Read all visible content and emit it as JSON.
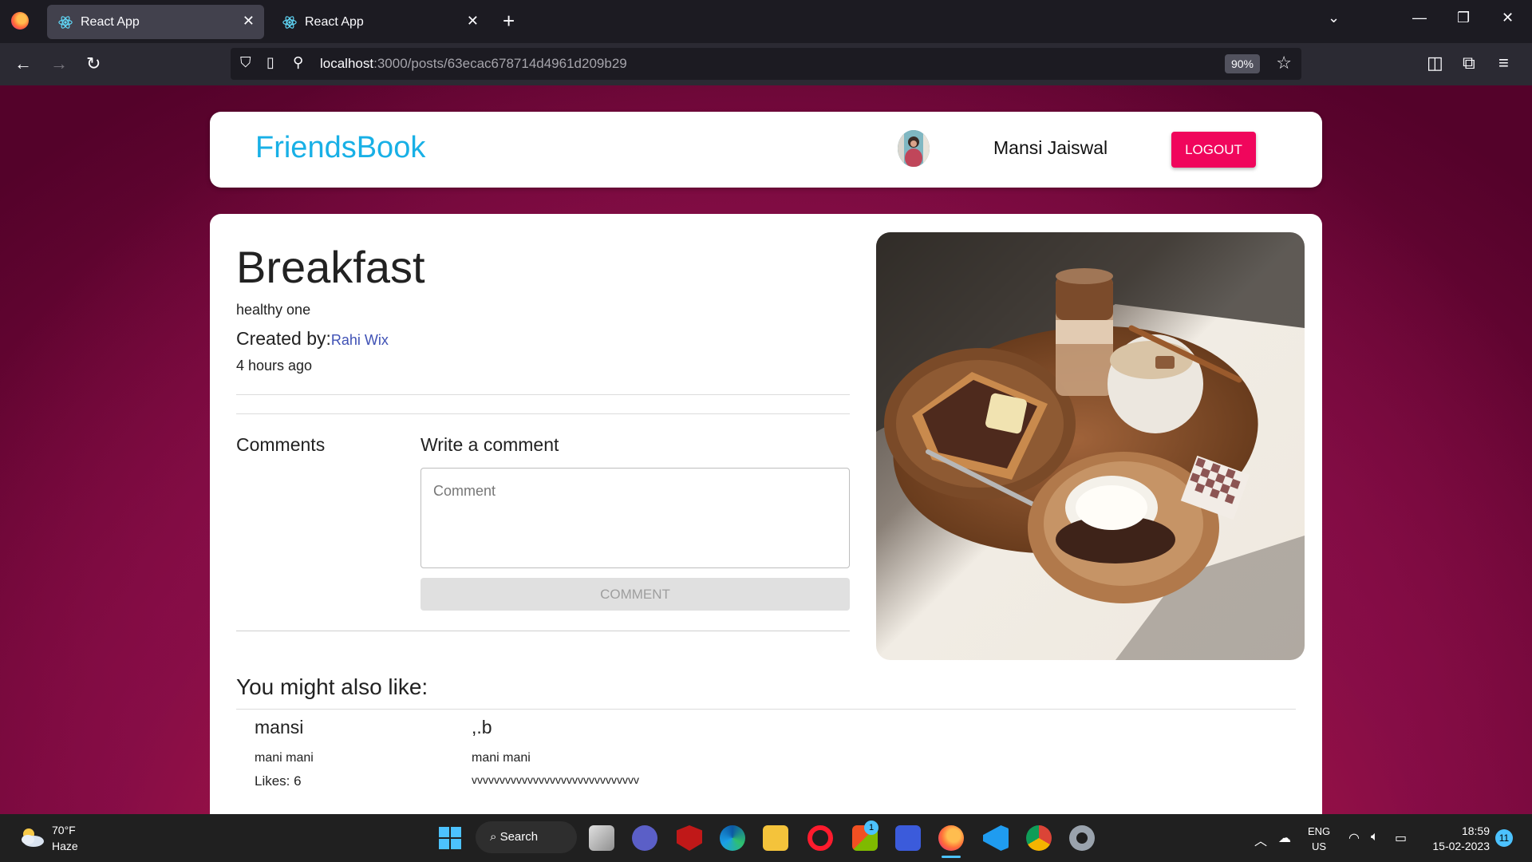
{
  "browser": {
    "tabs": [
      {
        "title": "React App",
        "active": true
      },
      {
        "title": "React App",
        "active": false
      }
    ],
    "url_host": "localhost",
    "url_rest": ":3000/posts/63ecac678714d4961d209b29",
    "zoom": "90%"
  },
  "app": {
    "brand": "FriendsBook",
    "user_name": "Mansi Jaiswal",
    "logout_label": "LOGOUT"
  },
  "post": {
    "title": "Breakfast",
    "message": "healthy one",
    "created_by_label": "Created by:",
    "creator": "Rahi Wix",
    "time_ago": "4 hours ago"
  },
  "comments": {
    "title": "Comments",
    "write_title": "Write a comment",
    "placeholder": "Comment",
    "button_label": "COMMENT"
  },
  "recommended": {
    "title": "You might also like:",
    "items": [
      {
        "title": "mansi",
        "author": "mani mani",
        "extra": "Likes: 6"
      },
      {
        "title": ",.b",
        "author": "mani mani",
        "extra": "vvvvvvvvvvvvvvvvvvvvvvvvvvvvvv"
      }
    ]
  },
  "taskbar": {
    "temperature": "70°F",
    "weather": "Haze",
    "search_label": "Search",
    "lang_1": "ENG",
    "lang_2": "US",
    "time": "18:59",
    "date": "15-02-2023",
    "notification_count": "11",
    "store_badge": "1"
  },
  "colors": {
    "brand": "#18b0e6",
    "logout": "#f0065c",
    "link": "#3f51b5"
  }
}
